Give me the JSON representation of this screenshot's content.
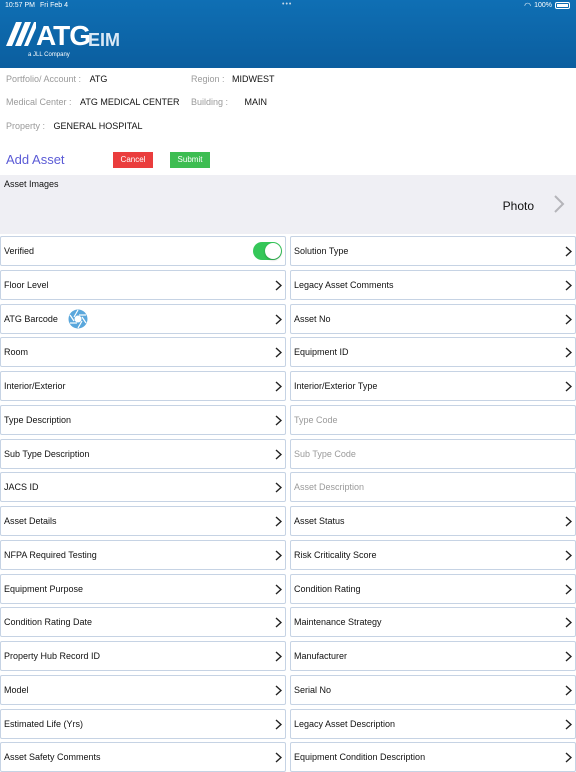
{
  "status_bar": {
    "time": "10:57 PM",
    "date": "Fri Feb 4",
    "battery": "100%"
  },
  "brand": {
    "logo_text": "ATG",
    "logo_suffix": "EIM",
    "tagline": "a JLL Company"
  },
  "info": {
    "portfolio_label": "Portfolio/ Account :",
    "portfolio_value": "ATG",
    "region_label": "Region :",
    "region_value": "MIDWEST",
    "medical_center_label": "Medical Center :",
    "medical_center_value": "ATG MEDICAL CENTER",
    "building_label": "Building :",
    "building_value": "MAIN",
    "property_label": "Property :",
    "property_value": "GENERAL HOSPITAL"
  },
  "form": {
    "title": "Add Asset",
    "cancel_label": "Cancel",
    "submit_label": "Submit"
  },
  "images": {
    "label": "Asset Images",
    "photo_label": "Photo"
  },
  "left_fields": [
    {
      "label": "Verified"
    },
    {
      "label": "Floor Level"
    },
    {
      "label": "ATG Barcode"
    },
    {
      "label": "Room"
    },
    {
      "label": "Interior/Exterior"
    },
    {
      "label": "Type Description"
    },
    {
      "label": "Sub Type Description"
    },
    {
      "label": "JACS ID"
    },
    {
      "label": "Asset Details"
    },
    {
      "label": "NFPA Required Testing"
    },
    {
      "label": "Equipment Purpose"
    },
    {
      "label": "Condition Rating Date"
    },
    {
      "label": "Property Hub Record ID"
    },
    {
      "label": "Model"
    },
    {
      "label": "Estimated Life (Yrs)"
    },
    {
      "label": "Asset Safety Comments"
    }
  ],
  "right_fields": [
    {
      "label": "Solution Type"
    },
    {
      "label": "Legacy Asset Comments"
    },
    {
      "label": "Asset No"
    },
    {
      "label": "Equipment ID"
    },
    {
      "label": "Interior/Exterior Type"
    },
    {
      "placeholder": "Type Code"
    },
    {
      "placeholder": "Sub Type Code"
    },
    {
      "placeholder": "Asset Description"
    },
    {
      "label": "Asset Status"
    },
    {
      "label": "Risk Criticality Score"
    },
    {
      "label": "Condition Rating"
    },
    {
      "label": "Maintenance Strategy"
    },
    {
      "label": "Manufacturer"
    },
    {
      "label": "Serial No"
    },
    {
      "label": "Legacy Asset Description"
    },
    {
      "label": "Equipment Condition Description"
    }
  ],
  "colors": {
    "header": "#0b5e9f",
    "accent": "#5b5bd6",
    "cancel": "#ea3d3d",
    "submit": "#3dbd52",
    "toggle_on": "#35c759"
  },
  "icons": {
    "chevron": "chevron-right-icon",
    "barcode": "camera-shutter-icon"
  }
}
